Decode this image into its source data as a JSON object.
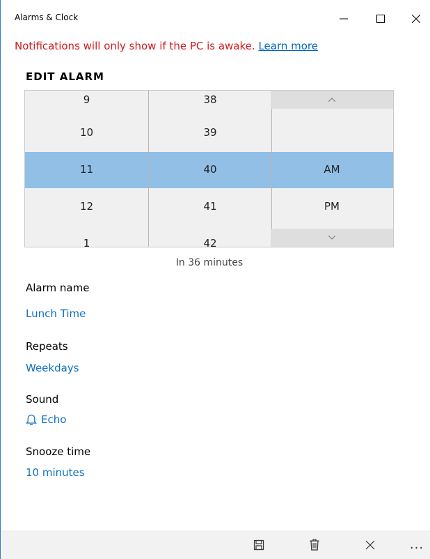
{
  "window": {
    "title": "Alarms & Clock"
  },
  "notice": {
    "text": "Notifications will only show if the PC is awake.",
    "link": "Learn more"
  },
  "heading": "EDIT ALARM",
  "picker": {
    "hours": [
      "9",
      "10",
      "11",
      "12",
      "1"
    ],
    "minutes": [
      "38",
      "39",
      "40",
      "41",
      "42"
    ],
    "ampm": [
      "AM",
      "PM"
    ],
    "selected": {
      "hour": "11",
      "minute": "40",
      "ampm": "AM"
    }
  },
  "countdown": "In 36 minutes",
  "fields": {
    "alarm_name_label": "Alarm name",
    "alarm_name_value": "Lunch Time",
    "repeats_label": "Repeats",
    "repeats_value": "Weekdays",
    "sound_label": "Sound",
    "sound_value": "Echo",
    "snooze_label": "Snooze time",
    "snooze_value": "10 minutes"
  },
  "commands": {
    "more_label": "..."
  },
  "icons": {
    "minimize": "minimize-icon",
    "maximize": "maximize-icon",
    "close": "close-icon",
    "bell": "bell-icon",
    "save": "save-icon",
    "delete": "delete-icon",
    "cancel": "close-icon"
  },
  "colors": {
    "accent": "#1070c0",
    "warning": "#d11a1a",
    "selection": "#91bfe6"
  }
}
